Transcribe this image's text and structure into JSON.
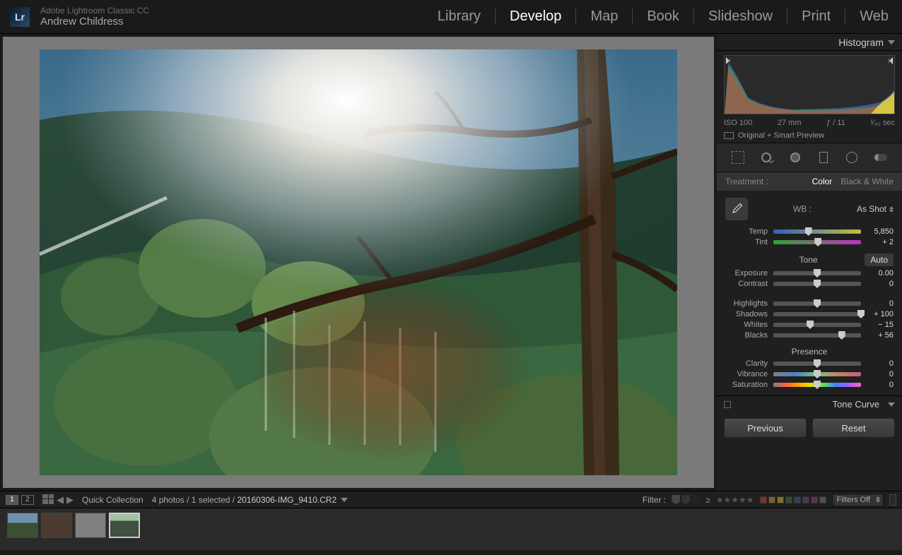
{
  "app": {
    "name": "Adobe Lightroom Classic CC",
    "user": "Andrew Childress",
    "logo_text": "Lr"
  },
  "nav": {
    "items": [
      "Library",
      "Develop",
      "Map",
      "Book",
      "Slideshow",
      "Print",
      "Web"
    ],
    "active": "Develop"
  },
  "right_panel": {
    "histogram": {
      "title": "Histogram",
      "iso": "ISO 100",
      "focal": "27 mm",
      "aperture": "ƒ / 11",
      "shutter": "¹⁄₄₀ sec",
      "preview_label": "Original + Smart Preview"
    },
    "treatment": {
      "label": "Treatment :",
      "color": "Color",
      "bw": "Black & White"
    },
    "basic": {
      "wb_label": "WB :",
      "wb_value": "As Shot",
      "temp": {
        "label": "Temp",
        "value": "5,850",
        "pos": 40
      },
      "tint": {
        "label": "Tint",
        "value": "+ 2",
        "pos": 51
      },
      "tone_title": "Tone",
      "auto_label": "Auto",
      "exposure": {
        "label": "Exposure",
        "value": "0.00",
        "pos": 50
      },
      "contrast": {
        "label": "Contrast",
        "value": "0",
        "pos": 50
      },
      "highlights": {
        "label": "Highlights",
        "value": "0",
        "pos": 50
      },
      "shadows": {
        "label": "Shadows",
        "value": "+ 100",
        "pos": 100
      },
      "whites": {
        "label": "Whites",
        "value": "− 15",
        "pos": 42
      },
      "blacks": {
        "label": "Blacks",
        "value": "+ 56",
        "pos": 78
      },
      "presence_title": "Presence",
      "clarity": {
        "label": "Clarity",
        "value": "0",
        "pos": 50
      },
      "vibrance": {
        "label": "Vibrance",
        "value": "0",
        "pos": 50
      },
      "saturation": {
        "label": "Saturation",
        "value": "0",
        "pos": 50
      }
    },
    "tone_curve_title": "Tone Curve",
    "previous_label": "Previous",
    "reset_label": "Reset"
  },
  "filmstrip": {
    "view1": "1",
    "view2": "2",
    "collection": "Quick Collection",
    "count": "4 photos / 1 selected /",
    "file": "20160306-IMG_9410.CR2",
    "filter_label": "Filter :",
    "filter_dropdown": "Filters Off",
    "geq": "≥",
    "stars": "★★★★★",
    "colors": [
      "#803030",
      "#806030",
      "#807030",
      "#305030",
      "#304060",
      "#503060",
      "#603050",
      "#505050"
    ]
  }
}
